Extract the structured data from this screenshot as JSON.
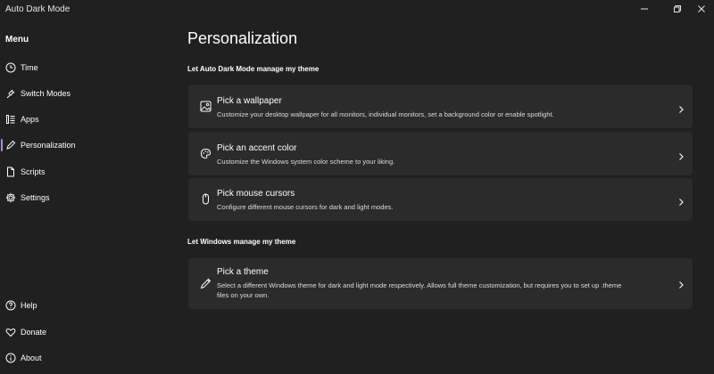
{
  "window": {
    "title": "Auto Dark Mode",
    "controls": [
      "minimize-icon",
      "restore-icon",
      "close-icon"
    ]
  },
  "sidebar": {
    "header": "Menu",
    "items": [
      {
        "label": "Time",
        "icon": "clock-icon"
      },
      {
        "label": "Switch Modes",
        "icon": "plug-icon"
      },
      {
        "label": "Apps",
        "icon": "list-icon"
      },
      {
        "label": "Personalization",
        "icon": "pen-icon",
        "selected": true
      },
      {
        "label": "Scripts",
        "icon": "document-icon"
      },
      {
        "label": "Settings",
        "icon": "gear-icon"
      }
    ],
    "footer_items": [
      {
        "label": "Help",
        "icon": "help-icon"
      },
      {
        "label": "Donate",
        "icon": "heart-icon"
      },
      {
        "label": "About",
        "icon": "info-icon"
      }
    ],
    "accent_color": "#b48ad8"
  },
  "main": {
    "title": "Personalization",
    "sections": [
      {
        "title": "Let Auto Dark Mode manage my theme",
        "cards": [
          {
            "title": "Pick a wallpaper",
            "description": "Customize your desktop wallpaper for all monitors, individual monitors, set a background color or enable spotlight.",
            "icon": "image-icon"
          },
          {
            "title": "Pick an accent color",
            "description": "Customize the Windows system color scheme to your liking.",
            "icon": "palette-icon"
          },
          {
            "title": "Pick mouse cursors",
            "description": "Configure different mouse cursors for dark and light modes.",
            "icon": "mouse-icon"
          }
        ]
      },
      {
        "title": "Let Windows manage my theme",
        "cards": [
          {
            "title": "Pick a theme",
            "description_line1": "Select a different Windows theme for dark and light mode respectively. Allows full theme customization, but requires you to set up .theme",
            "description_line2": "files on your own.",
            "icon": "brush-icon"
          }
        ]
      }
    ]
  },
  "colors": {
    "background": "#202020",
    "card": "#2b2b2b",
    "text": "#ffffff"
  }
}
